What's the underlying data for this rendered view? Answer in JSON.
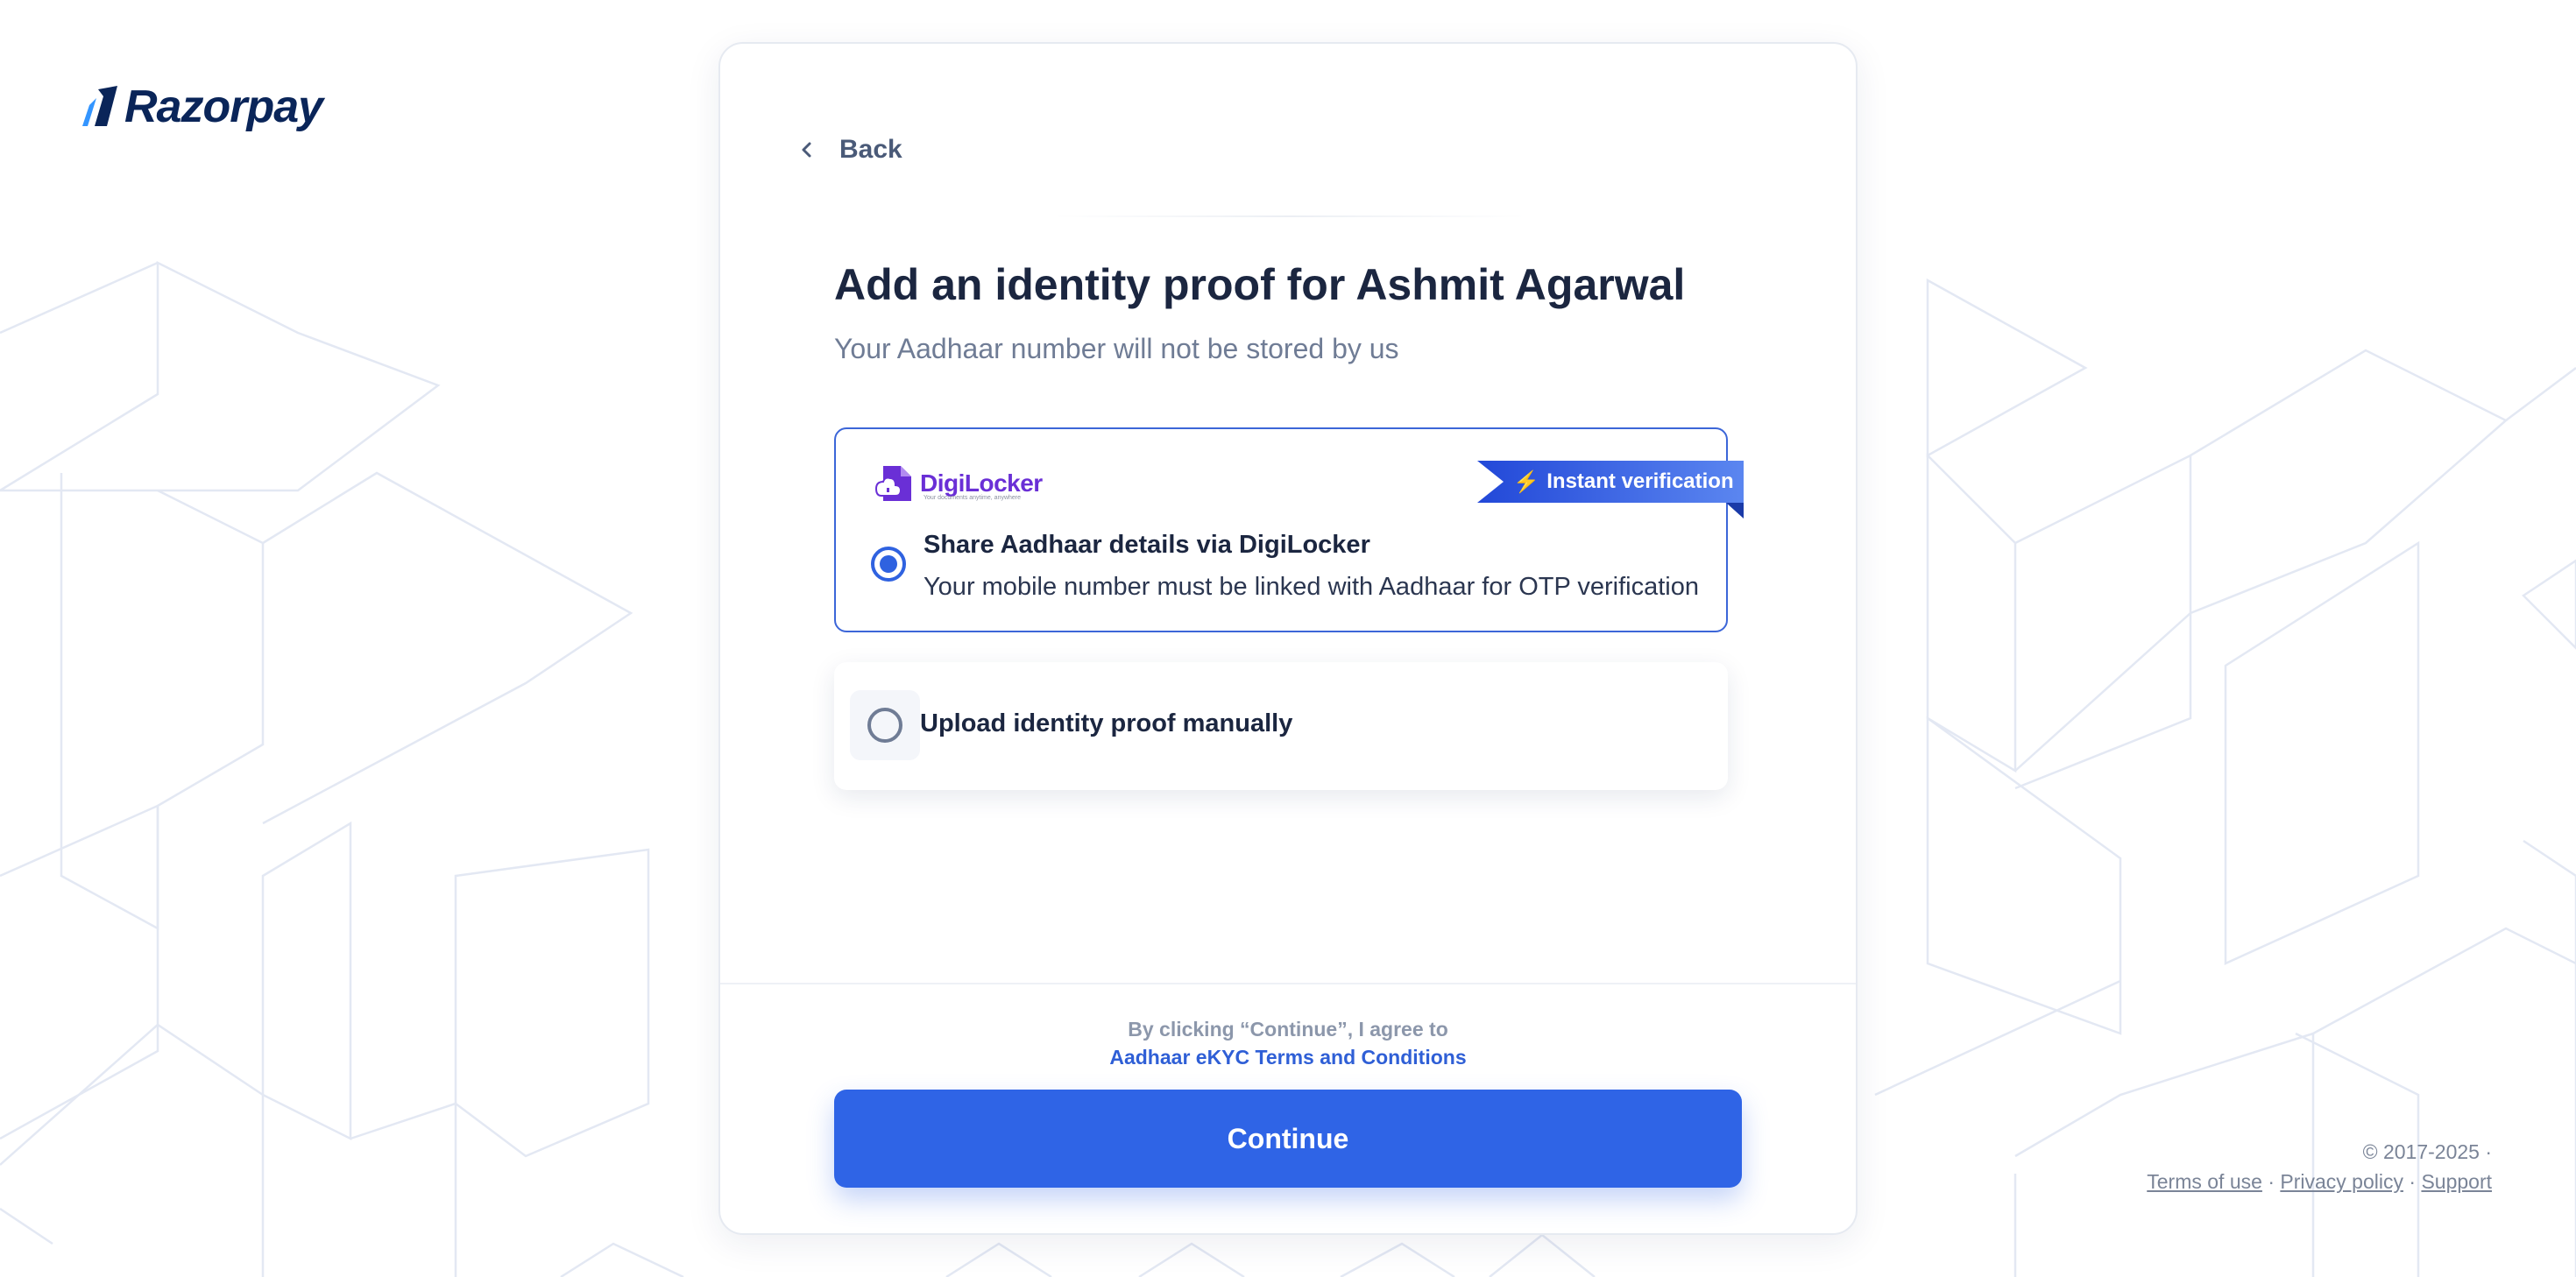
{
  "brand": {
    "name": "Razorpay",
    "color": "#0a2559",
    "accent": "#3395ff"
  },
  "back": {
    "label": "Back",
    "icon": "chevron-left-icon"
  },
  "page": {
    "title": "Add an identity proof for Ashmit Agarwal",
    "subtitle": "Your Aadhaar number will not be stored by us"
  },
  "options": {
    "digilocker": {
      "logo_text": "DigiLocker",
      "logo_tagline": "Your documents anytime, anywhere",
      "badge": "Instant verification",
      "badge_icon": "lightning-icon",
      "title": "Share Aadhaar details via DigiLocker",
      "description": "Your mobile number must be linked with Aadhaar for OTP verification",
      "selected": true
    },
    "manual": {
      "title": "Upload identity proof manually",
      "selected": false
    }
  },
  "consent": {
    "text": "By clicking “Continue”, I agree to",
    "link": "Aadhaar eKYC Terms and Conditions"
  },
  "continue_label": "Continue",
  "footer": {
    "copyright": "© 2017-2025 ·",
    "terms": "Terms of use",
    "privacy": "Privacy policy",
    "support": "Support",
    "separator": "·"
  },
  "colors": {
    "primary": "#2f64e6",
    "selected_border": "#3c66d8",
    "digilocker_purple": "#6a2fd6"
  }
}
